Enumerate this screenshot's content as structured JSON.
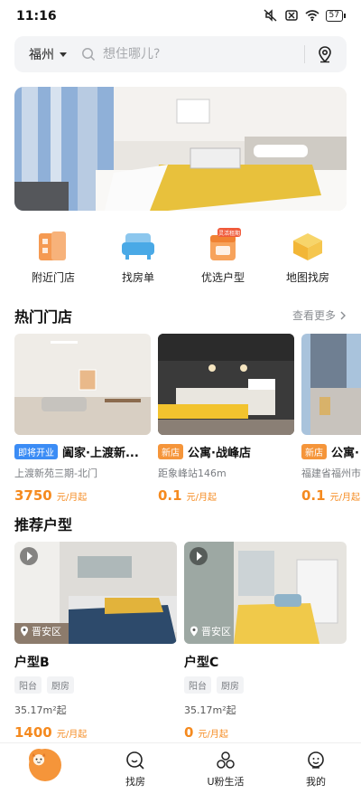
{
  "status_bar": {
    "time": "11:16",
    "battery": "57"
  },
  "search": {
    "city": "福州",
    "placeholder": "想住哪儿?"
  },
  "quick_entries": [
    {
      "label": "附近门店",
      "icon": "store-icon"
    },
    {
      "label": "找房单",
      "icon": "sofa-icon"
    },
    {
      "label": "优选户型",
      "icon": "calendar-icon",
      "badge": "灵活租期"
    },
    {
      "label": "地图找房",
      "icon": "map-box-icon"
    }
  ],
  "hot_stores": {
    "title": "热门门店",
    "more": "查看更多",
    "items": [
      {
        "badge": "即将开业",
        "name": "阖家·上渡新...",
        "addr": "上渡新苑三期-北门",
        "price": "3750",
        "unit": "元/月起"
      },
      {
        "badge": "新店",
        "name": "公寓·战峰店",
        "addr": "距象峰站146m",
        "price": "0.1",
        "unit": "元/月起"
      },
      {
        "badge": "新店",
        "name": "公寓·",
        "addr": "福建省福州市",
        "price": "0.1",
        "unit": "元/月起"
      }
    ]
  },
  "room_types": {
    "title": "推荐户型",
    "items": [
      {
        "district": "晋安区",
        "name": "户型B",
        "tags": [
          "阳台",
          "厨房"
        ],
        "area": "35.17m²起",
        "price": "1400",
        "unit": "元/月起"
      },
      {
        "district": "晋安区",
        "name": "户型C",
        "tags": [
          "阳台",
          "厨房"
        ],
        "area": "35.17m²起",
        "price": "0",
        "unit": "元/月起"
      }
    ]
  },
  "bottom_nav": [
    {
      "label": "",
      "icon": "mascot-icon"
    },
    {
      "label": "找房",
      "icon": "search-house-icon"
    },
    {
      "label": "U粉生活",
      "icon": "community-icon"
    },
    {
      "label": "我的",
      "icon": "profile-icon"
    }
  ],
  "colors": {
    "accent": "#f58a1f",
    "blue_badge": "#3b8cf5",
    "orange_badge": "#f5953a"
  }
}
